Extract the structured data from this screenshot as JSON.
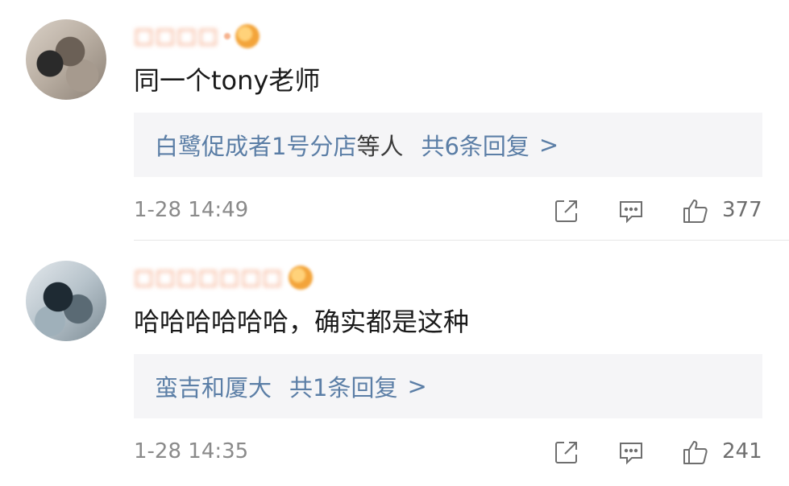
{
  "comments": [
    {
      "username": "□□□□",
      "text": "同一个tony老师",
      "reply": {
        "names": "白鹭促成者1号分店",
        "suffix": "等人",
        "count": "共6条回复",
        "arrow": ">"
      },
      "timestamp": "1-28 14:49",
      "likes": "377"
    },
    {
      "username": "□□□□□□□",
      "text": "哈哈哈哈哈哈，确实都是这种",
      "reply": {
        "names": "蛮吉和厦大",
        "suffix": "",
        "count": "共1条回复",
        "arrow": ">"
      },
      "timestamp": "1-28 14:35",
      "likes": "241"
    }
  ],
  "icons": {
    "share": "share-icon",
    "comment": "comment-icon",
    "like": "thumbs-up-icon"
  },
  "colors": {
    "link": "#5b7ea6",
    "username": "#f08a5d",
    "meta": "#8a8a8a",
    "reply_bg": "#f5f5f7"
  }
}
